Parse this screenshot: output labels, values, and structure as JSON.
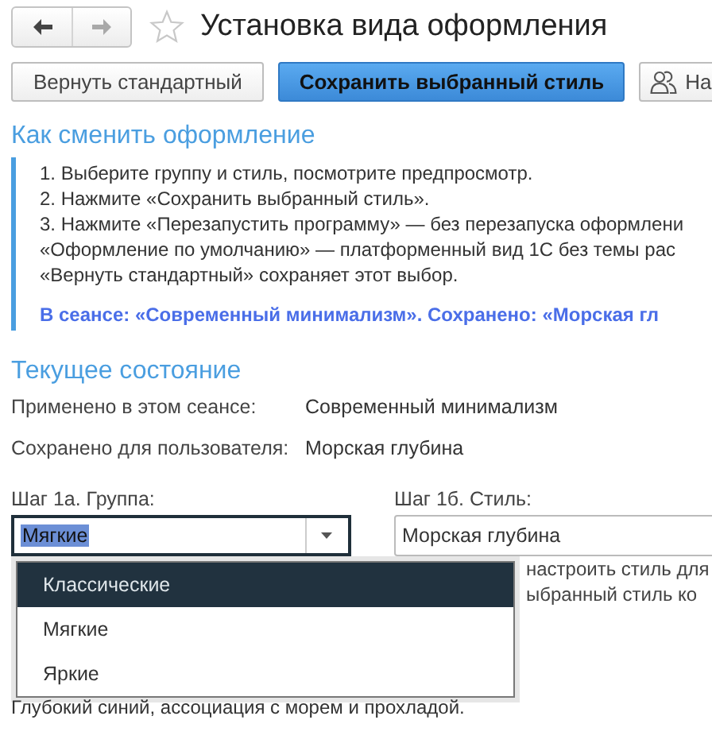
{
  "window": {
    "title": "Установка вида оформления",
    "favorite": false
  },
  "nav": [
    {
      "kind": "back",
      "disabled": false
    },
    {
      "kind": "forward",
      "disabled": true
    }
  ],
  "toolbar": [
    {
      "label": "Вернуть стандартный",
      "kind": "default"
    },
    {
      "label": "Сохранить выбранный стиль",
      "kind": "primary"
    },
    {
      "label": "На",
      "kind": "users"
    }
  ],
  "help": {
    "title": "Как сменить оформление",
    "lines": [
      "1. Выберите группу и стиль, посмотрите предпросмотр.",
      "2. Нажмите «Сохранить выбранный стиль».",
      "3. Нажмите «Перезапустить программу» — без перезапуска оформлени",
      "«Оформление по умолчанию» — платформенный вид 1С без темы рас",
      "«Вернуть стандартный» сохраняет этот выбор."
    ],
    "status": "В сеансе: «Современный минимализм». Сохранено: «Морская гл"
  },
  "state": {
    "title": "Текущее состояние",
    "rows": [
      {
        "label": "Применено в этом сеансе:",
        "value": "Современный минимализм"
      },
      {
        "label": "Сохранено для пользователя:",
        "value": "Морская глубина"
      }
    ]
  },
  "group": {
    "label": "Шаг 1а. Группа:",
    "value": "Мягкие",
    "expanded": true,
    "options": [
      {
        "label": "Классические",
        "highlighted": true
      },
      {
        "label": "Мягкие",
        "highlighted": false
      },
      {
        "label": "Яркие",
        "highlighted": false
      }
    ]
  },
  "style": {
    "label": "Шаг 1б. Стиль:",
    "value": "Морская глубина",
    "hint_lines": [
      "настроить стиль для",
      "ыбранный стиль ко"
    ]
  },
  "description": "Глубокий синий, ассоциация с морем и прохладой."
}
